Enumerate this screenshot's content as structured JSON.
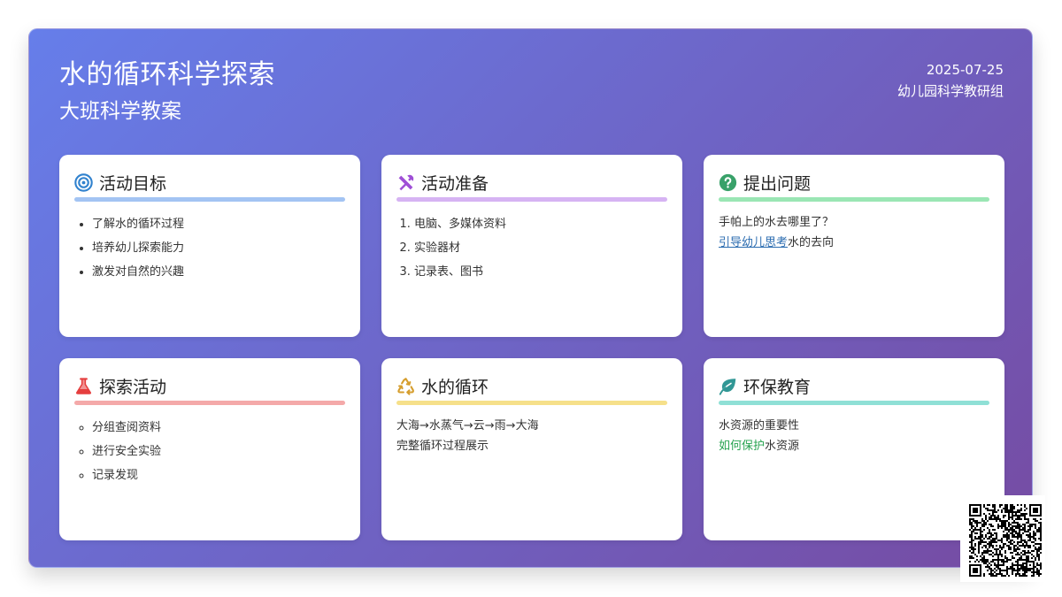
{
  "header": {
    "title": "水的循环科学探索",
    "subtitle": "大班科学教案",
    "date": "2025-07-25",
    "org": "幼儿园科学教研组"
  },
  "colors": {
    "gradient_start": "#667eea",
    "gradient_end": "#764ba2",
    "goal_accent": "#3182ce",
    "prep_accent": "#9f4fd6",
    "question_accent": "#38a169",
    "explore_accent": "#e53e3e",
    "cycle_accent": "#d69e2e",
    "eco_accent": "#319795"
  },
  "cards": {
    "goals": {
      "icon": "target-icon",
      "title": "活动目标",
      "items": [
        "了解水的循环过程",
        "培养幼儿探索能力",
        "激发对自然的兴趣"
      ]
    },
    "prep": {
      "icon": "tools-icon",
      "title": "活动准备",
      "items": [
        "电脑、多媒体资料",
        "实验器材",
        "记录表、图书"
      ]
    },
    "question": {
      "icon": "question-icon",
      "title": "提出问题",
      "line1": "手帕上的水去哪里了？",
      "line2_link": "引导幼儿思考",
      "line2_rest": "水的去向"
    },
    "explore": {
      "icon": "flask-icon",
      "title": "探索活动",
      "items": [
        "分组查阅资料",
        "进行安全实验",
        "记录发现"
      ]
    },
    "cycle": {
      "icon": "recycle-icon",
      "title": "水的循环",
      "line1": "大海→水蒸气→云→雨→大海",
      "line2": "完整循环过程展示"
    },
    "eco": {
      "icon": "leaf-icon",
      "title": "环保教育",
      "line1": "水资源的重要性",
      "line2_highlight": "如何保护",
      "line2_rest": "水资源"
    }
  },
  "qr": {
    "icon": "qr-code-icon"
  }
}
